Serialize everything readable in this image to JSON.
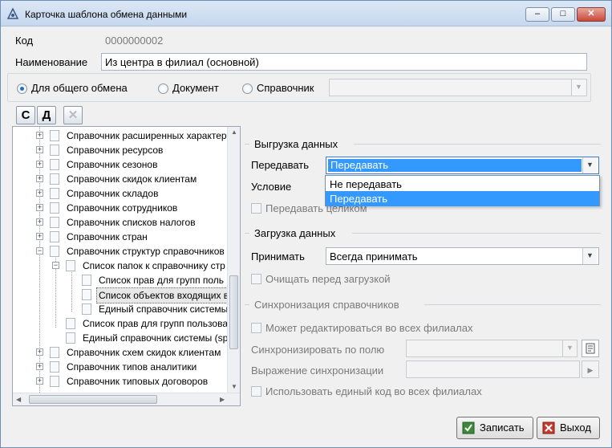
{
  "window": {
    "title": "Карточка шаблона обмена данными",
    "minimize": "–",
    "maximize": "□",
    "close": "✕"
  },
  "form": {
    "code_label": "Код",
    "code_value": "0000000002",
    "name_label": "Наименование",
    "name_value": "Из центра в филиал (основной)"
  },
  "radio": {
    "general": "Для общего обмена",
    "document": "Документ",
    "directory": "Справочник",
    "selected": "general",
    "directory_value": ""
  },
  "toolbar": {
    "btn_c": "С",
    "btn_d": "Д",
    "btn_x": "✕"
  },
  "tree": {
    "items": [
      "Справочник расширенных характер",
      "Справочник ресурсов",
      "Справочник сезонов",
      "Справочник скидок клиентам",
      "Справочник складов",
      "Справочник сотрудников",
      "Справочник списков  налогов",
      "Справочник стран",
      "Справочник структур справочников",
      "Список папок к справочнику стр",
      "Список прав для групп поль",
      "Список объектов входящих в",
      "Единый справочник системы",
      "Список прав для групп пользова",
      "Единый справочник системы (sp",
      "Справочник схем скидок клиентам",
      "Справочник типов аналитики",
      "Справочник типовых договоров"
    ]
  },
  "export": {
    "section": "Выгрузка данных",
    "transfer_label": "Передавать",
    "transfer_value": "Передавать",
    "condition_label": "Условие",
    "whole_label": "Передавать целиком",
    "options": [
      "Не передавать",
      "Передавать"
    ]
  },
  "import": {
    "section": "Загрузка данных",
    "accept_label": "Принимать",
    "accept_value": "Всегда принимать",
    "clear_label": "Очищать перед загрузкой"
  },
  "sync": {
    "section": "Синхронизация справочников",
    "editable_label": "Может редактироваться во всех филиалах",
    "by_field_label": "Синхронизировать по полю",
    "expression_label": "Выражение синхронизации",
    "single_code_label": "Использовать единый код во всех филиалах"
  },
  "buttons": {
    "save": "Записать",
    "exit": "Выход"
  }
}
